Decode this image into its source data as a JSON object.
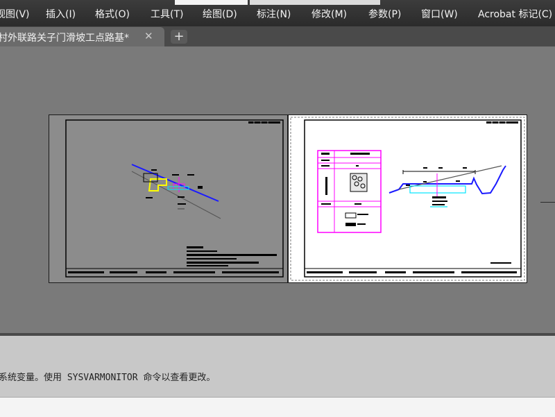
{
  "menu": {
    "items": [
      {
        "label": "视图(V)"
      },
      {
        "label": "插入(I)"
      },
      {
        "label": "格式(O)"
      },
      {
        "label": "工具(T)"
      },
      {
        "label": "绘图(D)"
      },
      {
        "label": "标注(N)"
      },
      {
        "label": "修改(M)"
      },
      {
        "label": "参数(P)"
      },
      {
        "label": "窗口(W)"
      },
      {
        "label": "Acrobat 标记(C)"
      }
    ]
  },
  "tabs": {
    "active": {
      "label": "村外联路关子门滑坡工点路基*",
      "close_glyph": "✕"
    },
    "new_glyph": "+"
  },
  "command": {
    "history": "系统变量。使用 SYSVARMONITOR 命令以查看更改。",
    "input": ""
  },
  "colors": {
    "menubar": "#2f2f2f",
    "canvas": "#7a7a7a",
    "sheet": "#ffffff",
    "slope_line": "#1a1aff",
    "magenta_table": "#ff00ff",
    "cyan_structure": "#00e5ff",
    "yellow_retaining": "#ffff00"
  }
}
